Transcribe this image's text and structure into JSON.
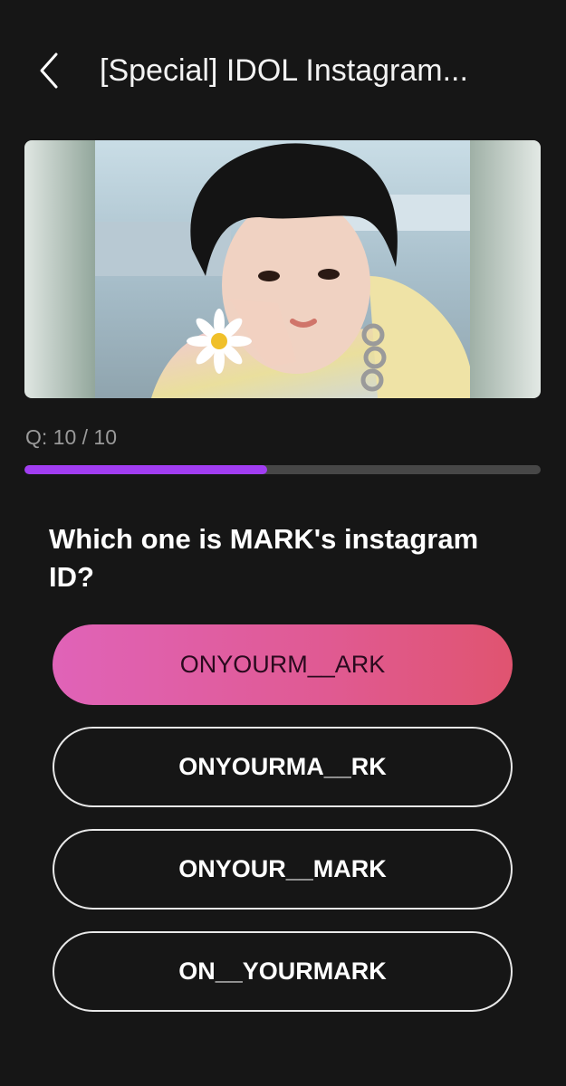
{
  "header": {
    "title": "[Special] IDOL Instagram...",
    "back_icon": "chevron-left-icon"
  },
  "hero": {
    "image_alt": "Young man in pastel hoodie holding a daisy to his face"
  },
  "progress": {
    "label": "Q: 10 / 10",
    "fill_fraction": 0.47,
    "fill_color": "#a13df2"
  },
  "question": {
    "text": "Which one is MARK's instagram ID?"
  },
  "options": [
    {
      "label": "ONYOURM__ARK",
      "selected": true
    },
    {
      "label": "ONYOURMA__RK",
      "selected": false
    },
    {
      "label": "ONYOUR__MARK",
      "selected": false
    },
    {
      "label": "ON__YOURMARK",
      "selected": false
    }
  ],
  "colors": {
    "background": "#161616",
    "accent_gradient_start": "#e063b8",
    "accent_gradient_end": "#e05470"
  }
}
